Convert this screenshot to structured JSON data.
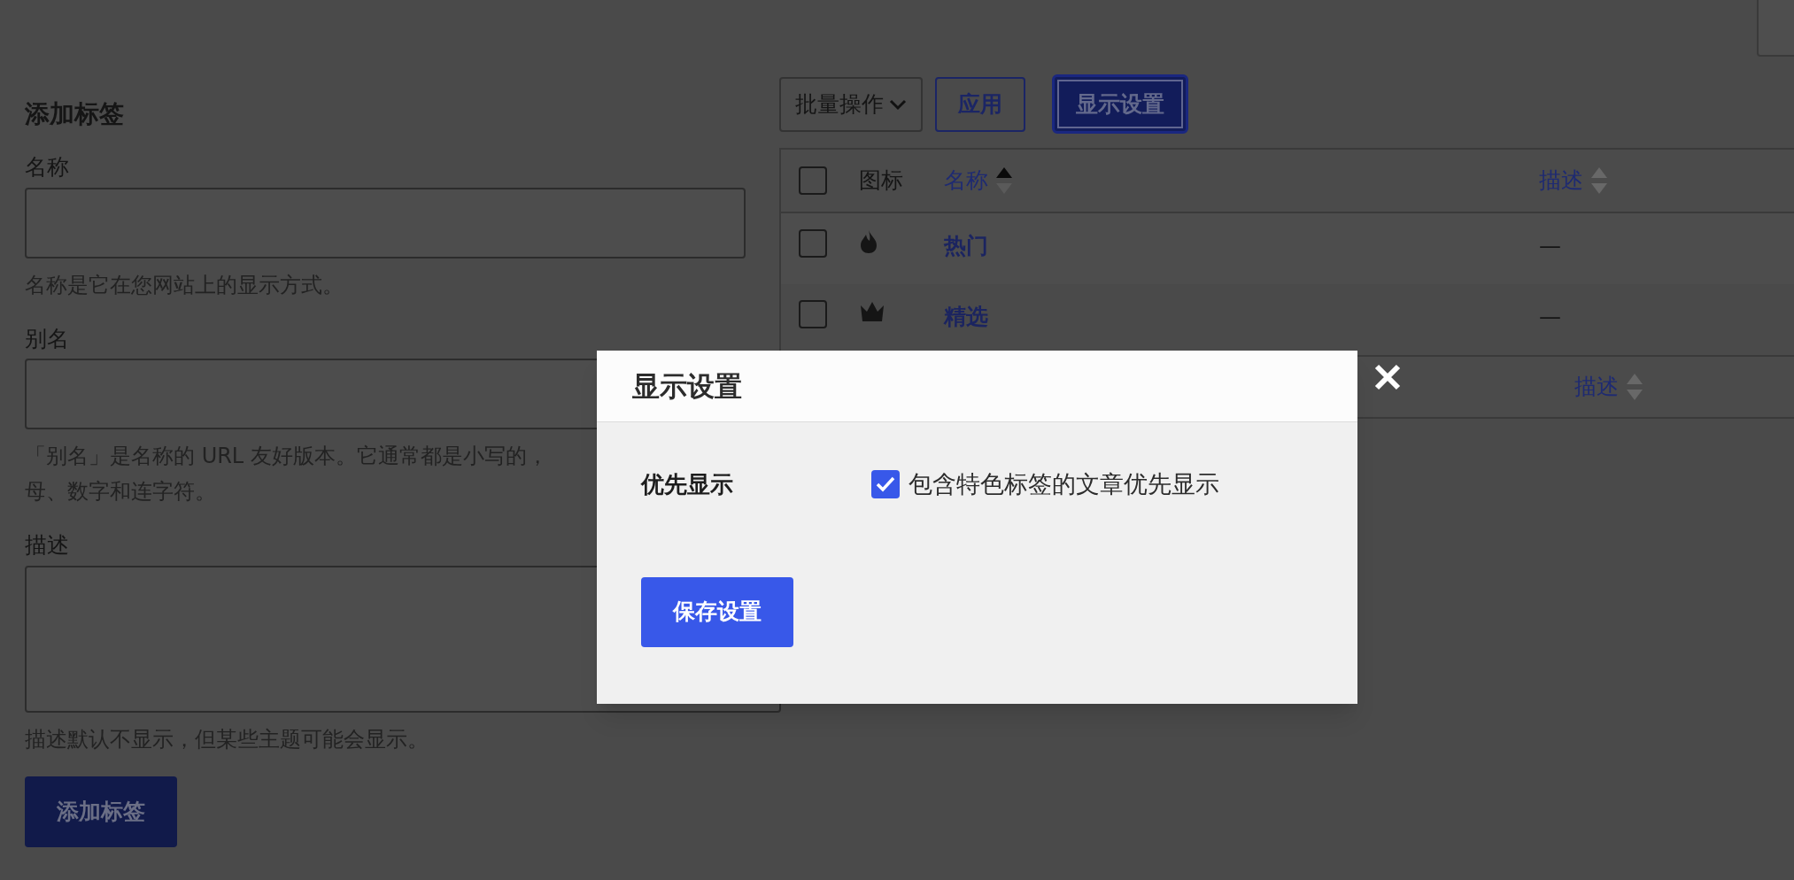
{
  "form": {
    "title": "添加标签",
    "fields": [
      {
        "label": "名称",
        "kind": "input",
        "hints": [
          "名称是它在您网站上的显示方式。"
        ]
      },
      {
        "label": "别名",
        "kind": "input",
        "hints": [
          "「别名」是名称的 URL 友好版本。它通常都是小写的，",
          "母、数字和连字符。"
        ]
      },
      {
        "label": "描述",
        "kind": "textarea",
        "hints": [
          "描述默认不显示，但某些主题可能会显示。"
        ]
      }
    ],
    "submit": "添加标签"
  },
  "toolbar": {
    "bulk_actions": "批量操作",
    "apply": "应用",
    "display_settings": "显示设置"
  },
  "table": {
    "select_all_checked": false,
    "columns": [
      {
        "label": "图标",
        "sortable": false
      },
      {
        "label": "名称",
        "sorted_ascending": true,
        "sortable": true
      },
      {
        "label": "描述",
        "sorted_ascending": false,
        "sortable": true
      }
    ],
    "rows": [
      {
        "kind": "flame",
        "name": "热门",
        "description": "—",
        "checked": false
      },
      {
        "kind": "crown",
        "name": "精选",
        "description": "—",
        "checked": false
      }
    ],
    "footer_columns": [
      {
        "label": "描述",
        "sorted_ascending": false,
        "sortable": true
      }
    ]
  },
  "dialog": {
    "title": "显示设置",
    "settings": [
      {
        "label": "优先显示",
        "option": "包含特色标签的文章优先显示",
        "checked": true
      }
    ],
    "save": "保存设置"
  }
}
